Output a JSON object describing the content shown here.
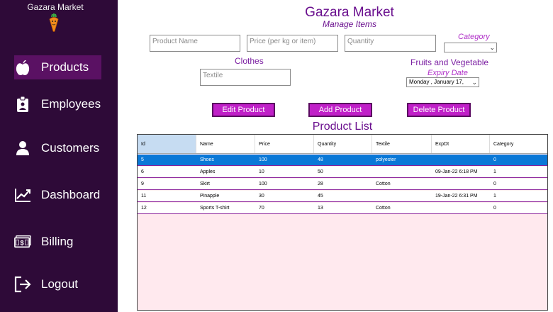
{
  "sidebar": {
    "brand": "Gazara Market",
    "items": [
      {
        "label": "Products",
        "icon": "apple-icon",
        "active": true
      },
      {
        "label": "Employees",
        "icon": "id-badge-icon",
        "active": false
      },
      {
        "label": "Customers",
        "icon": "user-icon",
        "active": false
      },
      {
        "label": "Dashboard",
        "icon": "chart-trend-icon",
        "active": false
      },
      {
        "label": "Billing",
        "icon": "money-icon",
        "active": false
      },
      {
        "label": "Logout",
        "icon": "logout-icon",
        "active": false
      }
    ]
  },
  "header": {
    "title": "Gazara Market",
    "subtitle": "Manage Items"
  },
  "form": {
    "product_name_placeholder": "Product Name",
    "price_placeholder": "Price (per kg or item)",
    "quantity_placeholder": "Quantity",
    "category_label": "Category",
    "category_value": "",
    "clothes_label": "Clothes",
    "textile_placeholder": "Textile",
    "fruits_label": "Fruits and Vegetable",
    "expiry_label": "Expiry Date",
    "expiry_value": "Monday  ,  January  17,"
  },
  "buttons": {
    "edit": "Edit Product",
    "add": "Add Product",
    "delete": "Delete Product"
  },
  "list_title": "Product List",
  "table": {
    "columns": [
      "Id",
      "Name",
      "Price",
      "Quantity",
      "Textile",
      "ExpDt",
      "Category"
    ],
    "rows": [
      [
        "5",
        "Shoes",
        "100",
        "48",
        "polyester",
        "",
        "0"
      ],
      [
        "6",
        "Apples",
        "10",
        "50",
        "",
        "09-Jan-22 6:18 PM",
        "1"
      ],
      [
        "9",
        "Skirt",
        "100",
        "28",
        "Cotton",
        "",
        "0"
      ],
      [
        "11",
        "Pinapple",
        "30",
        "45",
        "",
        "19-Jan-22 6:31 PM",
        "1"
      ],
      [
        "12",
        "Sports T-shirt",
        "70",
        "13",
        "Cotton",
        "",
        "0"
      ]
    ],
    "selected_row": 0
  },
  "colors": {
    "sidebar_bg": "#2e0a38",
    "sidebar_active": "#5a1163",
    "accent": "#c020c8",
    "title": "#6a0f8e",
    "selection": "#0a78d7",
    "grid_bg": "#ffe9ee"
  }
}
